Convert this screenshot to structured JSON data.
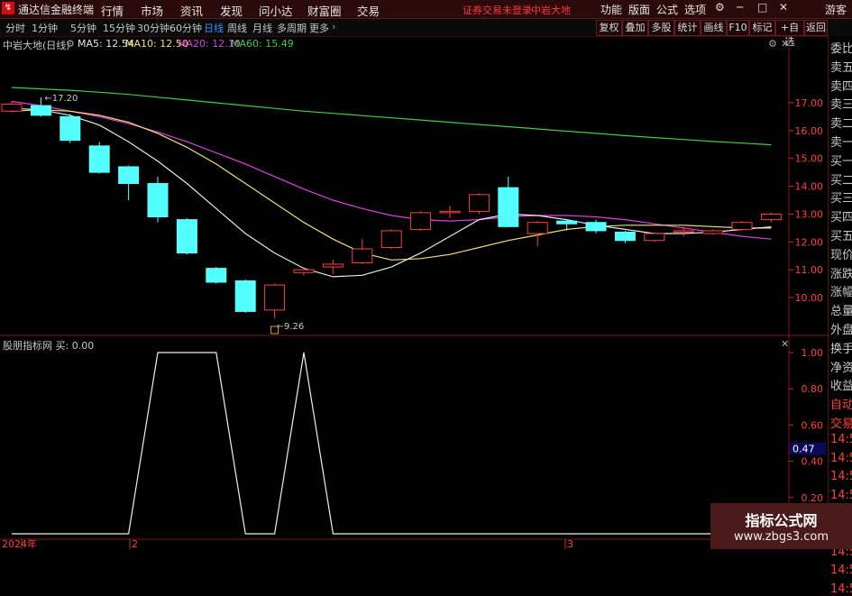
{
  "titlebar": {
    "app_title": "通达信金融终端",
    "menu": [
      "行情",
      "市场",
      "资讯",
      "发现",
      "问小达",
      "财富圈",
      "交易"
    ],
    "status_left": "证券交易未登录",
    "status_right": "中岩大地",
    "right_menu": [
      "功能",
      "版面",
      "公式",
      "选项"
    ],
    "guest": "游客"
  },
  "periods": [
    "分时",
    "1分钟",
    "5分钟",
    "15分钟",
    "30分钟",
    "60分钟",
    "日线",
    "周线",
    "月线",
    "多周期",
    "更多"
  ],
  "active_period": "日线",
  "toolbar_right": [
    "复权",
    "叠加",
    "多股",
    "统计",
    "画线",
    "F10",
    "标记",
    "+自选",
    "返回"
  ],
  "chart": {
    "stock_label": "中岩大地(日线)",
    "ma_legend": [
      {
        "label": "MA5: 12.54",
        "color": "#e8e8e8"
      },
      {
        "label": "MA10: 12.50",
        "color": "#f0e070"
      },
      {
        "label": "MA20: 12.10",
        "color": "#e040e0"
      },
      {
        "label": "MA60: 15.49",
        "color": "#40d040"
      }
    ],
    "high_mark": "17.20",
    "low_mark": "9.26",
    "y_ticks": [
      "17.00",
      "16.00",
      "15.00",
      "14.00",
      "13.00",
      "12.00",
      "11.00",
      "10.00"
    ],
    "candles": [
      {
        "o": 16.7,
        "c": 16.95,
        "h": 17.05,
        "l": 16.65,
        "up": true
      },
      {
        "o": 16.55,
        "c": 16.9,
        "h": 17.2,
        "l": 16.5,
        "up": false
      },
      {
        "o": 16.5,
        "c": 15.65,
        "h": 16.6,
        "l": 15.55,
        "up": false
      },
      {
        "o": 15.45,
        "c": 14.5,
        "h": 15.6,
        "l": 14.45,
        "up": false
      },
      {
        "o": 14.7,
        "c": 14.1,
        "h": 14.75,
        "l": 13.5,
        "up": false
      },
      {
        "o": 14.1,
        "c": 12.9,
        "h": 14.35,
        "l": 12.7,
        "up": false
      },
      {
        "o": 12.8,
        "c": 11.6,
        "h": 12.85,
        "l": 11.55,
        "up": false
      },
      {
        "o": 11.05,
        "c": 10.55,
        "h": 11.1,
        "l": 10.5,
        "up": false
      },
      {
        "o": 10.6,
        "c": 9.5,
        "h": 10.65,
        "l": 9.45,
        "up": false
      },
      {
        "o": 9.55,
        "c": 10.45,
        "h": 10.5,
        "l": 9.26,
        "up": true
      },
      {
        "o": 10.9,
        "c": 11.0,
        "h": 11.1,
        "l": 10.8,
        "up": true
      },
      {
        "o": 11.1,
        "c": 11.2,
        "h": 11.35,
        "l": 10.85,
        "up": true
      },
      {
        "o": 11.25,
        "c": 11.75,
        "h": 12.1,
        "l": 11.2,
        "up": true
      },
      {
        "o": 11.8,
        "c": 12.4,
        "h": 12.45,
        "l": 11.75,
        "up": true
      },
      {
        "o": 12.45,
        "c": 13.05,
        "h": 13.1,
        "l": 12.4,
        "up": true
      },
      {
        "o": 13.05,
        "c": 13.1,
        "h": 13.3,
        "l": 12.85,
        "up": true
      },
      {
        "o": 13.1,
        "c": 13.7,
        "h": 13.75,
        "l": 13.0,
        "up": true
      },
      {
        "o": 13.95,
        "c": 12.55,
        "h": 14.35,
        "l": 12.55,
        "up": false
      },
      {
        "o": 12.3,
        "c": 12.7,
        "h": 12.75,
        "l": 11.85,
        "up": true
      },
      {
        "o": 12.75,
        "c": 12.65,
        "h": 12.8,
        "l": 12.4,
        "up": false
      },
      {
        "o": 12.7,
        "c": 12.4,
        "h": 12.8,
        "l": 12.3,
        "up": false
      },
      {
        "o": 12.35,
        "c": 12.05,
        "h": 12.4,
        "l": 11.95,
        "up": false
      },
      {
        "o": 12.05,
        "c": 12.3,
        "h": 12.35,
        "l": 12.0,
        "up": true
      },
      {
        "o": 12.4,
        "c": 12.4,
        "h": 12.55,
        "l": 12.2,
        "up": true
      },
      {
        "o": 12.3,
        "c": 12.4,
        "h": 12.45,
        "l": 12.25,
        "up": true
      },
      {
        "o": 12.45,
        "c": 12.7,
        "h": 12.75,
        "l": 12.4,
        "up": true
      },
      {
        "o": 12.8,
        "c": 13.0,
        "h": 13.05,
        "l": 12.7,
        "up": true
      }
    ],
    "ma5": [
      16.8,
      16.75,
      16.55,
      16.2,
      15.6,
      14.9,
      14.1,
      13.2,
      12.3,
      11.6,
      11.05,
      10.75,
      10.8,
      11.1,
      11.6,
      12.2,
      12.8,
      13.0,
      12.95,
      12.8,
      12.6,
      12.45,
      12.3,
      12.3,
      12.35,
      12.45,
      12.54
    ],
    "ma10": [
      16.7,
      16.75,
      16.7,
      16.55,
      16.3,
      15.9,
      15.4,
      14.8,
      14.1,
      13.4,
      12.7,
      12.1,
      11.6,
      11.35,
      11.4,
      11.55,
      11.8,
      12.05,
      12.25,
      12.45,
      12.55,
      12.6,
      12.6,
      12.6,
      12.55,
      12.5,
      12.5
    ],
    "ma20": [
      17.05,
      16.9,
      16.7,
      16.5,
      16.25,
      15.95,
      15.6,
      15.2,
      14.8,
      14.35,
      13.9,
      13.5,
      13.2,
      12.95,
      12.8,
      12.75,
      12.8,
      12.9,
      12.95,
      12.95,
      12.9,
      12.8,
      12.65,
      12.5,
      12.35,
      12.2,
      12.1
    ],
    "ma60": [
      17.55,
      17.5,
      17.45,
      17.38,
      17.3,
      17.2,
      17.1,
      17.0,
      16.9,
      16.8,
      16.7,
      16.62,
      16.54,
      16.46,
      16.38,
      16.3,
      16.22,
      16.14,
      16.06,
      15.98,
      15.9,
      15.82,
      15.75,
      15.68,
      15.61,
      15.55,
      15.49
    ]
  },
  "indicator": {
    "label": "股朋指标网  买: 0.00",
    "y_ticks": [
      "1.00",
      "0.80",
      "0.60",
      "0.40",
      "0.20"
    ],
    "current_value": "0.47",
    "values": [
      0,
      0,
      0,
      0,
      0,
      1,
      1,
      1,
      0,
      0,
      1,
      0,
      0,
      0,
      0,
      0,
      0,
      0,
      0,
      0,
      0,
      0,
      0,
      0,
      0,
      0,
      0
    ]
  },
  "xaxis": {
    "labels": [
      "2024年",
      "2",
      "3"
    ]
  },
  "right_panel": {
    "items": [
      "委比",
      "卖五",
      "卖四",
      "卖三",
      "卖二",
      "卖一",
      "买一",
      "买二",
      "买三",
      "买四",
      "买五",
      "现价",
      "涨跌",
      "涨幅",
      "总量",
      "外盘",
      "换手",
      "净资",
      "收益",
      "自动",
      "交易",
      "14:56",
      "14:56",
      "14:56",
      "14:56",
      "14:56",
      "14:56",
      "14:56",
      "14:56",
      "14:56"
    ]
  },
  "watermark": {
    "line1": "指标公式网",
    "line2": "www.zbgs3.com"
  }
}
